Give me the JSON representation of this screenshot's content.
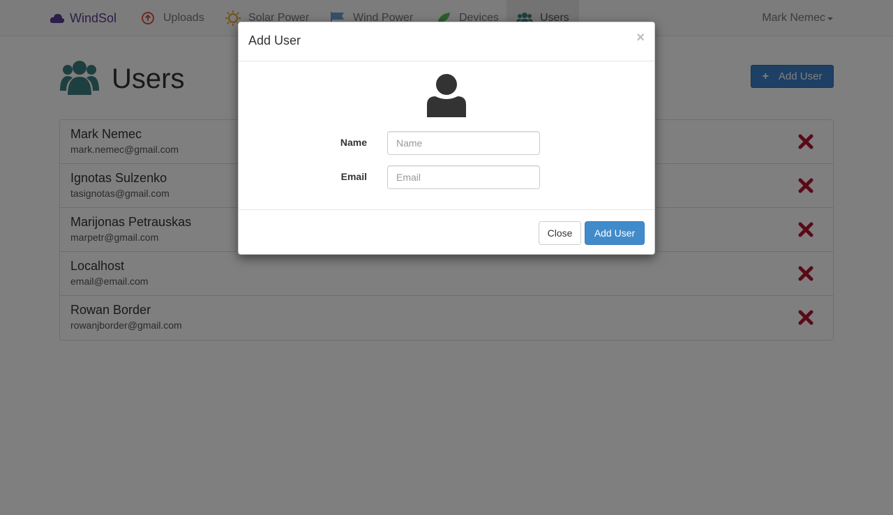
{
  "navbar": {
    "brand": "WindSol",
    "items": [
      {
        "label": "Uploads",
        "icon": "upload-circle-icon"
      },
      {
        "label": "Solar Power",
        "icon": "sun-icon"
      },
      {
        "label": "Wind Power",
        "icon": "flag-icon"
      },
      {
        "label": "Devices",
        "icon": "leaf-icon"
      },
      {
        "label": "Users",
        "icon": "users-icon",
        "active": true
      }
    ],
    "user_menu": "Mark Nemec"
  },
  "page": {
    "title": "Users",
    "add_button": "Add User"
  },
  "users": [
    {
      "name": "Mark Nemec",
      "email": "mark.nemec@gmail.com"
    },
    {
      "name": "Ignotas Sulzenko",
      "email": "tasignotas@gmail.com"
    },
    {
      "name": "Marijonas Petrauskas",
      "email": "marpetr@gmail.com"
    },
    {
      "name": "Localhost",
      "email": "email@email.com"
    },
    {
      "name": "Rowan Border",
      "email": "rowanjborder@gmail.com"
    }
  ],
  "modal": {
    "title": "Add User",
    "close_symbol": "×",
    "name_label": "Name",
    "name_placeholder": "Name",
    "email_label": "Email",
    "email_placeholder": "Email",
    "close_button": "Close",
    "submit_button": "Add User"
  },
  "colors": {
    "brand": "#5b3b94",
    "primary": "#428bca",
    "delete": "#b3152e",
    "users_icon": "#3c7f7e"
  }
}
